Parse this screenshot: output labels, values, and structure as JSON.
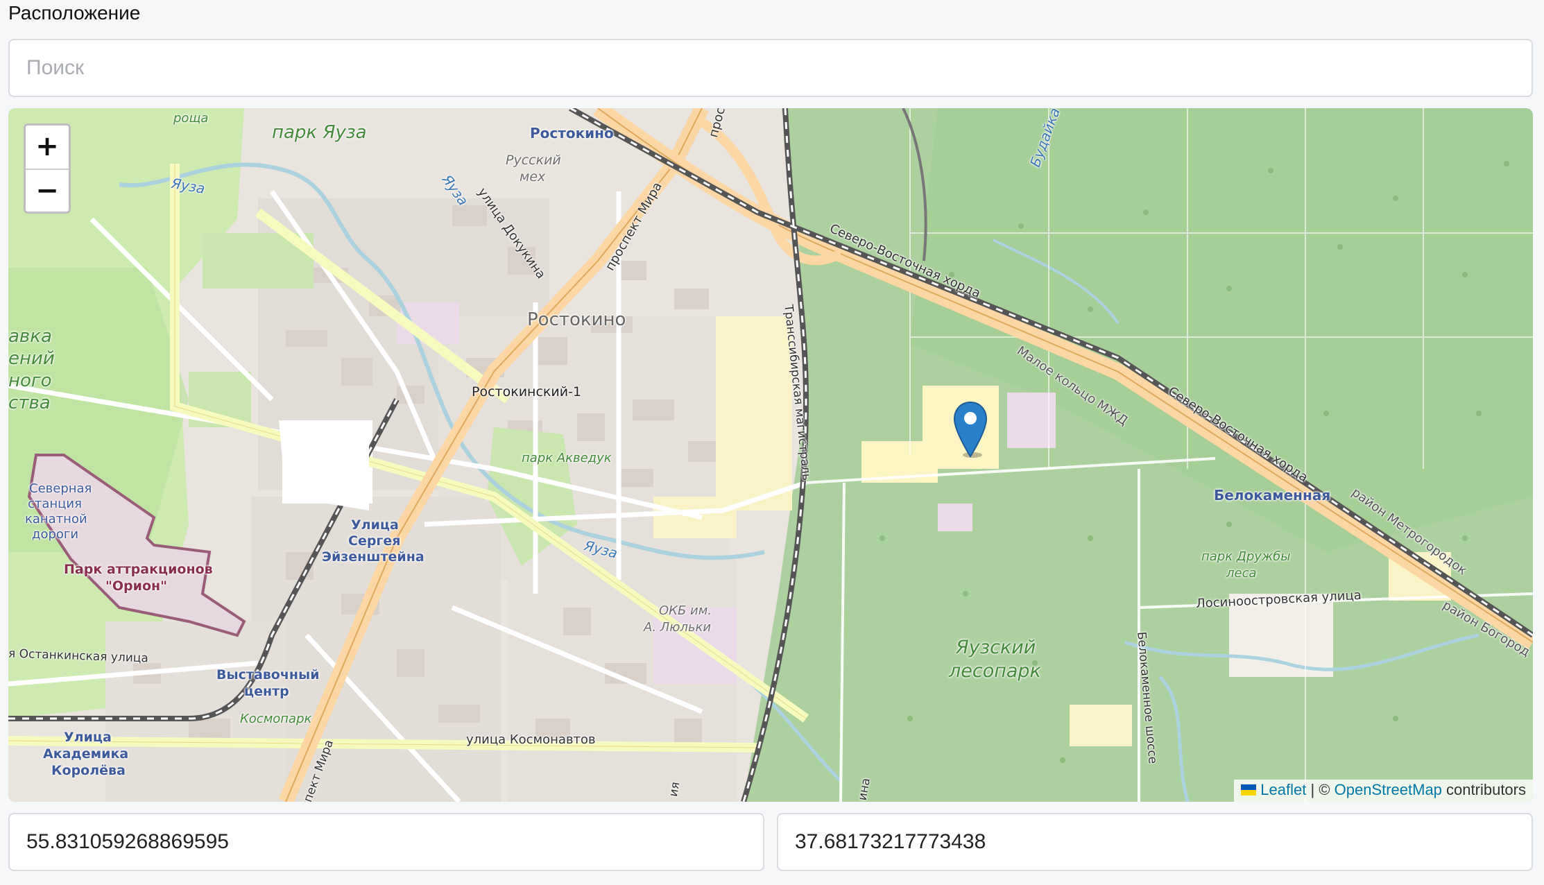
{
  "field": {
    "label": "Расположение",
    "search_placeholder": "Поиск",
    "latitude": "55.831059268869595",
    "longitude": "37.68173217773438"
  },
  "map": {
    "zoom_in": "+",
    "zoom_out": "−",
    "attribution": {
      "leaflet": "Leaflet",
      "sep": "| ©",
      "osm": "OpenStreetMap",
      "suffix": "contributors"
    },
    "marker_color": "#2a81cb",
    "labels": {
      "park_yauza": "парк Яуза",
      "roscha": "роща",
      "yauza_river_1": "Яуза",
      "yauza_river_2": "Яуза",
      "yauza_river_3": "Яуза",
      "rostokino_top": "Ростокино",
      "russkiy_mekh_1": "Русский",
      "russkiy_mekh_2": "мех",
      "dokukina": "улица Докукина",
      "prospekt_mira_top": "проспект Мира",
      "prosp": "прос",
      "budayka": "Будайка",
      "sv_khorda_1": "Северо-Восточная хорда",
      "sv_khorda_2": "Северо-Восточная хорда",
      "rostokino_mid": "Ростокино",
      "transsib": "Транссибирская магистраль",
      "maloe_koltso": "Малое кольцо МЖД",
      "rostokinsky": "Ростокинский-1",
      "park_akveduk": "парк Акведук",
      "belokamennaya": "Белокаменная",
      "rayon_metrogorodok": "район Метрогородок",
      "park_druzhby_1": "парк Дружбы",
      "park_druzhby_2": "леса",
      "losinoostrovskaya": "Лосиноостровская улица",
      "rayon_bogorod": "район Богород",
      "yauzsky_1": "Яузский",
      "yauzsky_2": "лесопарк",
      "belokamennoe_sh": "Белокаменное шоссе",
      "okb_1": "ОКБ им.",
      "okb_2": "А. Люльки",
      "eisenstein_1": "Улица",
      "eisenstein_2": "Сергея",
      "eisenstein_3": "Эйзенштейна",
      "severnaya_1": "Северная",
      "severnaya_2": "станция",
      "severnaya_3": "канатной",
      "severnaya_4": "дороги",
      "orion_1": "Парк аттракционов",
      "orion_2": "\"Орион\"",
      "ostankinskaya": "я Останкинская улица",
      "vystavochny_1": "Выставочный",
      "vystavochny_2": "центр",
      "kosmopark": "Космопарк",
      "kosmonavtov": "улица Космонавтов",
      "akademika_1": "Улица",
      "akademika_2": "Академика",
      "akademika_3": "Королёва",
      "prospekt_mira_bottom": "роспект Мира",
      "edge_1": "авка",
      "edge_2": "ений",
      "edge_3": "ного",
      "edge_4": "ства",
      "edge_bottom": "ия",
      "edge_bottom2": "ина"
    }
  }
}
